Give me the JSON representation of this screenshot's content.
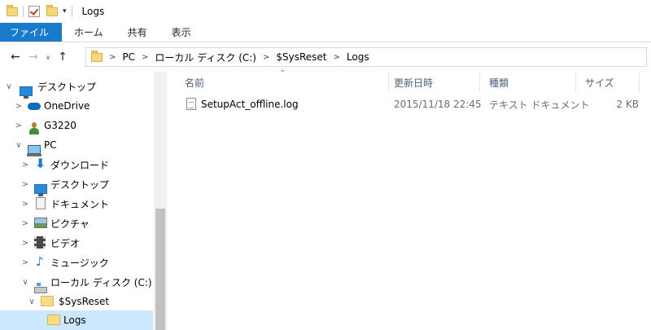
{
  "window": {
    "title": "Logs"
  },
  "ribbon": {
    "tabs": [
      "ファイル",
      "ホーム",
      "共有",
      "表示"
    ]
  },
  "nav": {
    "back": "←",
    "forward": "→",
    "recent": "∨",
    "up": "↑"
  },
  "address": {
    "crumbs": [
      "PC",
      "ローカル ディスク (C:)",
      "$SysReset",
      "Logs"
    ]
  },
  "sidebar": {
    "items": [
      {
        "label": "デスクトップ",
        "icon": "desktop-icon",
        "chevron": "∨"
      },
      {
        "label": "OneDrive",
        "icon": "onedrive-icon",
        "chevron": ">"
      },
      {
        "label": "G3220",
        "icon": "user-icon",
        "chevron": ">"
      },
      {
        "label": "PC",
        "icon": "pc-icon",
        "chevron": "∨"
      },
      {
        "label": "ダウンロード",
        "icon": "download-icon",
        "chevron": ">"
      },
      {
        "label": "デスクトップ",
        "icon": "desktop-icon",
        "chevron": ">"
      },
      {
        "label": "ドキュメント",
        "icon": "documents-icon",
        "chevron": ">"
      },
      {
        "label": "ピクチャ",
        "icon": "pictures-icon",
        "chevron": ">"
      },
      {
        "label": "ビデオ",
        "icon": "videos-icon",
        "chevron": ">"
      },
      {
        "label": "ミュージック",
        "icon": "music-icon",
        "chevron": ">"
      },
      {
        "label": "ローカル ディスク (C:)",
        "icon": "drive-icon",
        "chevron": "∨"
      },
      {
        "label": "$SysReset",
        "icon": "folder-icon",
        "chevron": "∨"
      },
      {
        "label": "Logs",
        "icon": "folder-icon",
        "chevron": ""
      }
    ]
  },
  "columns": {
    "name": "名前",
    "modified": "更新日時",
    "type": "種類",
    "size": "サイズ"
  },
  "files": [
    {
      "name": "SetupAct_offline.log",
      "modified": "2015/11/18 22:45",
      "type": "テキスト ドキュメント",
      "size": "2 KB"
    }
  ],
  "colors": {
    "accent": "#1979ca",
    "selection": "#cce8ff",
    "header_text": "#4c607a"
  }
}
